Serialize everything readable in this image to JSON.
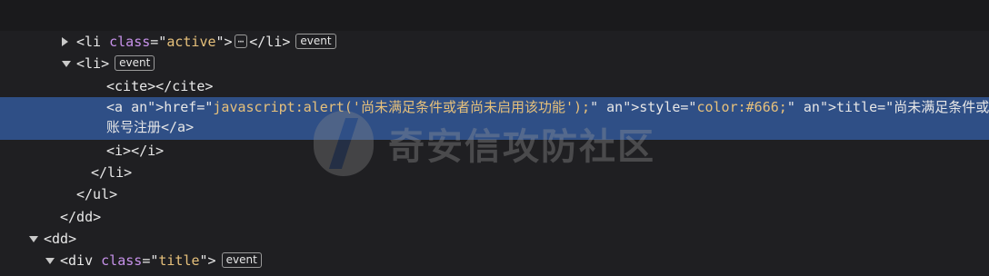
{
  "watermark": {
    "text": "奇安信攻防社区"
  },
  "nodes": [
    {
      "indent": 84,
      "twisty": "closed",
      "parts": [
        {
          "k": "tag",
          "t": "<li "
        },
        {
          "k": "an",
          "t": "class"
        },
        {
          "k": "pl",
          "t": "=\""
        },
        {
          "k": "av",
          "t": "active"
        },
        {
          "k": "pl",
          "t": "\">"
        }
      ],
      "ellipsis": "⋯",
      "after": "</li>",
      "badge": "event"
    },
    {
      "indent": 84,
      "twisty": "open",
      "parts": [
        {
          "k": "tag",
          "t": "<li>"
        }
      ],
      "badge": "event"
    },
    {
      "indent": 117,
      "parts": [
        {
          "k": "tag",
          "t": "<cite></cite>"
        }
      ]
    },
    {
      "indent": 117,
      "selected": true,
      "line1": "<a href=\"javascript:alert('尚未满足条件或者尚未启用该功能');\" style=\"color:#666;\" title=\"尚未满足条件或",
      "line2": "账号注册</a>"
    },
    {
      "indent": 117,
      "parts": [
        {
          "k": "tag",
          "t": "<i></i>"
        }
      ]
    },
    {
      "indent": 100,
      "parts": [
        {
          "k": "tag",
          "t": "</li>"
        }
      ]
    },
    {
      "indent": 84,
      "parts": [
        {
          "k": "tag",
          "t": "</ul>"
        }
      ]
    },
    {
      "indent": 66,
      "parts": [
        {
          "k": "tag",
          "t": "</dd>"
        }
      ]
    },
    {
      "indent": 48,
      "twisty": "open",
      "parts": [
        {
          "k": "tag",
          "t": "<dd>"
        }
      ]
    },
    {
      "indent": 66,
      "twisty": "open",
      "parts": [
        {
          "k": "tag",
          "t": "<div "
        },
        {
          "k": "an",
          "t": "class"
        },
        {
          "k": "pl",
          "t": "=\""
        },
        {
          "k": "av",
          "t": "title"
        },
        {
          "k": "pl",
          "t": "\">"
        }
      ],
      "badge": "event"
    }
  ]
}
